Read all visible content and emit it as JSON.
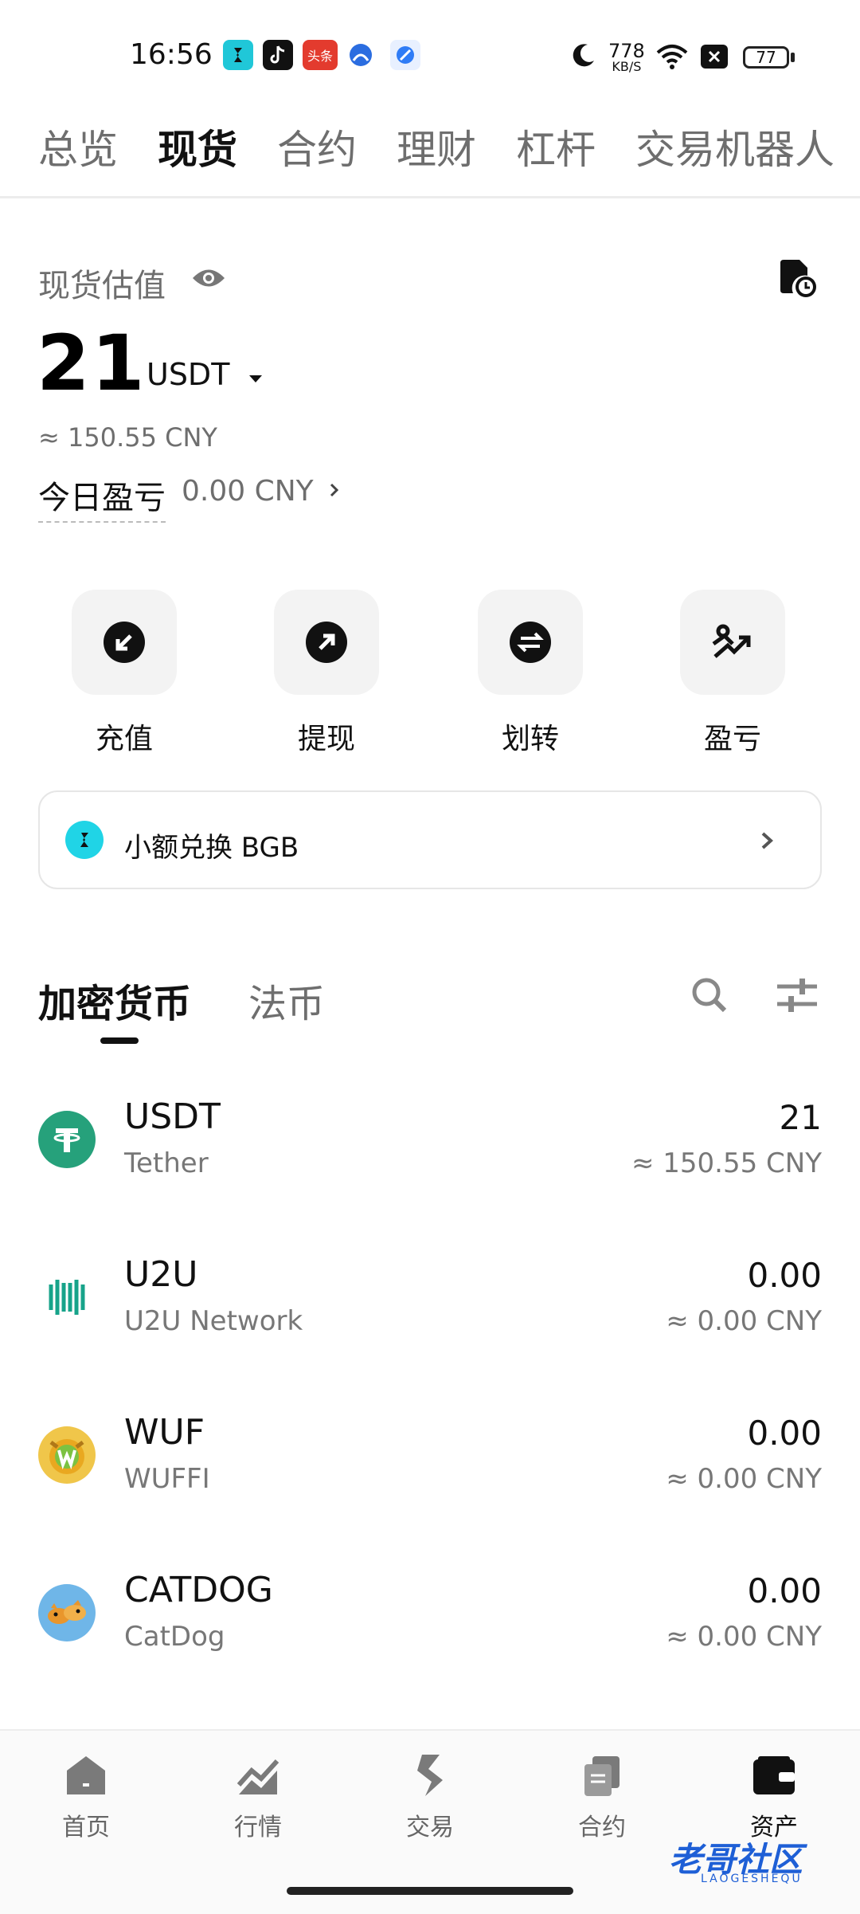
{
  "status_bar": {
    "time": "16:56",
    "net_speed_value": "778",
    "net_speed_unit": "KB/S",
    "battery": "77",
    "notification_badge_toutiao": "头条"
  },
  "top_tabs": [
    {
      "label": "总览",
      "active": false
    },
    {
      "label": "现货",
      "active": true
    },
    {
      "label": "合约",
      "active": false
    },
    {
      "label": "理财",
      "active": false
    },
    {
      "label": "杠杆",
      "active": false
    },
    {
      "label": "交易机器人",
      "active": false
    }
  ],
  "overview": {
    "title": "现货估值",
    "value": "21",
    "unit": "USDT",
    "approx": "≈ 150.55 CNY",
    "pnl_label": "今日盈亏",
    "pnl_value": "0.00 CNY"
  },
  "quick_actions": [
    {
      "label": "充值",
      "icon": "deposit-icon"
    },
    {
      "label": "提现",
      "icon": "withdraw-icon"
    },
    {
      "label": "划转",
      "icon": "transfer-icon"
    },
    {
      "label": "盈亏",
      "icon": "pnl-icon"
    }
  ],
  "banner": {
    "text": "小额兑换 BGB"
  },
  "list_tabs": [
    {
      "label": "加密货币",
      "active": true
    },
    {
      "label": "法币",
      "active": false
    }
  ],
  "assets": [
    {
      "symbol": "USDT",
      "name": "Tether",
      "amount": "21",
      "fiat": "≈ 150.55 CNY",
      "color": "#26a17b"
    },
    {
      "symbol": "U2U",
      "name": "U2U Network",
      "amount": "0.00",
      "fiat": "≈ 0.00 CNY",
      "color": "#17a38a"
    },
    {
      "symbol": "WUF",
      "name": "WUFFI",
      "amount": "0.00",
      "fiat": "≈ 0.00 CNY",
      "color": "#e7b62c"
    },
    {
      "symbol": "CATDOG",
      "name": "CatDog",
      "amount": "0.00",
      "fiat": "≈ 0.00 CNY",
      "color": "#4aa3df"
    }
  ],
  "bottom_nav": [
    {
      "label": "首页",
      "icon": "home-icon",
      "active": false
    },
    {
      "label": "行情",
      "icon": "market-chart-icon",
      "active": false
    },
    {
      "label": "交易",
      "icon": "trade-icon",
      "active": false
    },
    {
      "label": "合约",
      "icon": "contract-icon",
      "active": false
    },
    {
      "label": "资产",
      "icon": "wallet-icon",
      "active": true
    }
  ],
  "watermark": {
    "text": "老哥社区",
    "sub": "LAOGESHEQU"
  }
}
